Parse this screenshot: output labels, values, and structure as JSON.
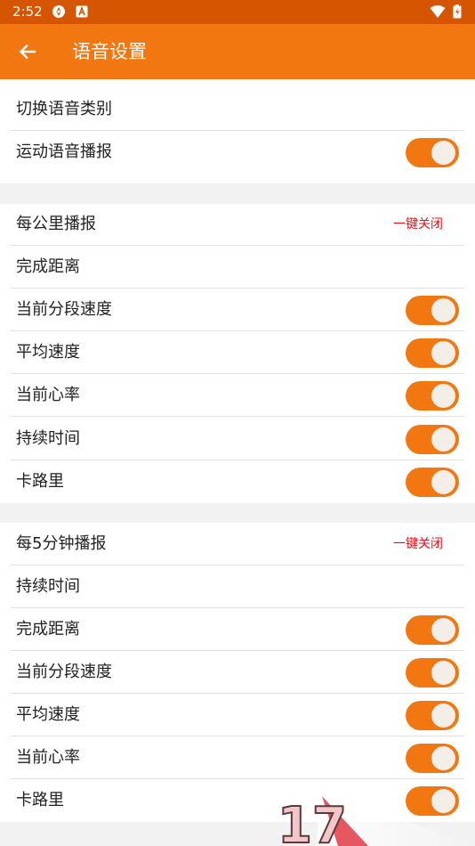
{
  "status_bar": {
    "time": "2:52"
  },
  "app_bar": {
    "title": "语音设置",
    "back_icon": "arrow-left-icon"
  },
  "sections": [
    {
      "rows": [
        {
          "label": "切换语音类别",
          "toggle": false
        },
        {
          "label": "运动语音播报",
          "toggle": true,
          "on": true
        }
      ]
    },
    {
      "header": {
        "label": "每公里播报",
        "action": "一键关闭"
      },
      "rows": [
        {
          "label": "完成距离",
          "toggle": false
        },
        {
          "label": "当前分段速度",
          "toggle": true,
          "on": true
        },
        {
          "label": "平均速度",
          "toggle": true,
          "on": true
        },
        {
          "label": "当前心率",
          "toggle": true,
          "on": true
        },
        {
          "label": "持续时间",
          "toggle": true,
          "on": true
        },
        {
          "label": "卡路里",
          "toggle": true,
          "on": true
        }
      ]
    },
    {
      "header": {
        "label": "每5分钟播报",
        "action": "一键关闭"
      },
      "rows": [
        {
          "label": "持续时间",
          "toggle": false
        },
        {
          "label": "完成距离",
          "toggle": true,
          "on": true
        },
        {
          "label": "当前分段速度",
          "toggle": true,
          "on": true
        },
        {
          "label": "平均速度",
          "toggle": true,
          "on": true
        },
        {
          "label": "当前心率",
          "toggle": true,
          "on": true
        },
        {
          "label": "卡路里",
          "toggle": true,
          "on": true
        }
      ]
    }
  ],
  "watermark": {
    "text": "17"
  },
  "colors": {
    "accent": "#f27711",
    "status_bar": "#d55500",
    "action_red": "#e8101a",
    "background": "#f2f2f2"
  }
}
